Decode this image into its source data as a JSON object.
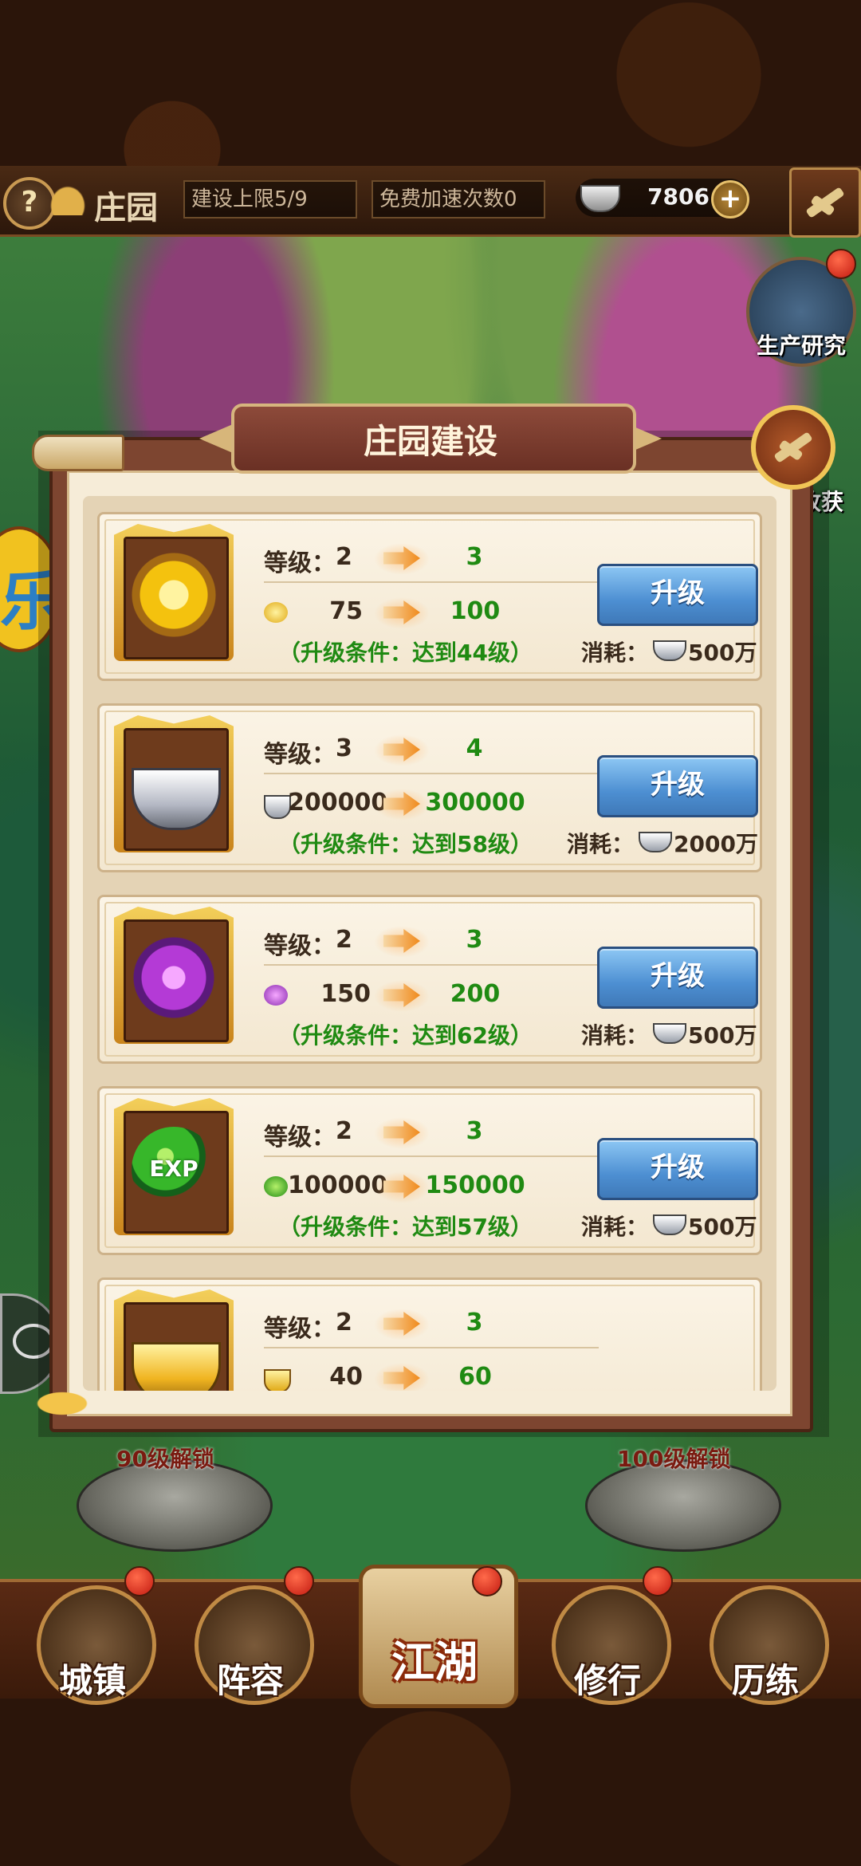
{
  "header": {
    "help_icon": "?",
    "title": "庄园",
    "build_limit": "建设上限5/9",
    "free_speedups": "免费加速次数0",
    "silver": "7806",
    "plus": "+"
  },
  "side": {
    "research_label": "生产研究",
    "harvest_label": "收获"
  },
  "dialog": {
    "title": "庄园建设",
    "level_label": "等级：",
    "cost_label": "消耗：",
    "upgrade_label": "升级",
    "cards": [
      {
        "icon": "gold-spirit-icon",
        "level_from": "2",
        "level_to": "3",
        "res_icon": "gold-spirit-icon",
        "value_from": "75",
        "value_to": "100",
        "condition": "（升级条件：达到44级）",
        "cost": "500万"
      },
      {
        "icon": "silver-ingot-icon",
        "level_from": "3",
        "level_to": "4",
        "res_icon": "silver-ingot-icon",
        "value_from": "200000",
        "value_to": "300000",
        "condition": "（升级条件：达到58级）",
        "cost": "2000万"
      },
      {
        "icon": "purple-crystal-icon",
        "level_from": "2",
        "level_to": "3",
        "res_icon": "purple-crystal-icon",
        "value_from": "150",
        "value_to": "200",
        "condition": "（升级条件：达到62级）",
        "cost": "500万"
      },
      {
        "icon": "exp-orb-icon",
        "level_from": "2",
        "level_to": "3",
        "res_icon": "exp-orb-icon",
        "value_from": "100000",
        "value_to": "150000",
        "condition": "（升级条件：达到57级）",
        "cost": "500万"
      },
      {
        "icon": "gold-ingot-icon",
        "level_from": "2",
        "level_to": "3",
        "res_icon": "gold-ingot-icon",
        "value_from": "40",
        "value_to": "60"
      }
    ],
    "exp_text": "EXP"
  },
  "map": {
    "lock_left": "90级解锁",
    "lock_right": "100级解锁",
    "edge_glyph": "乐"
  },
  "nav": {
    "town": "城镇",
    "lineup": "阵容",
    "jianghu": "江湖",
    "practice": "修行",
    "training": "历练"
  },
  "colors": {
    "accent_green": "#1f8a12",
    "button_blue": "#4d8fd2",
    "frame_brown": "#7d4530"
  }
}
